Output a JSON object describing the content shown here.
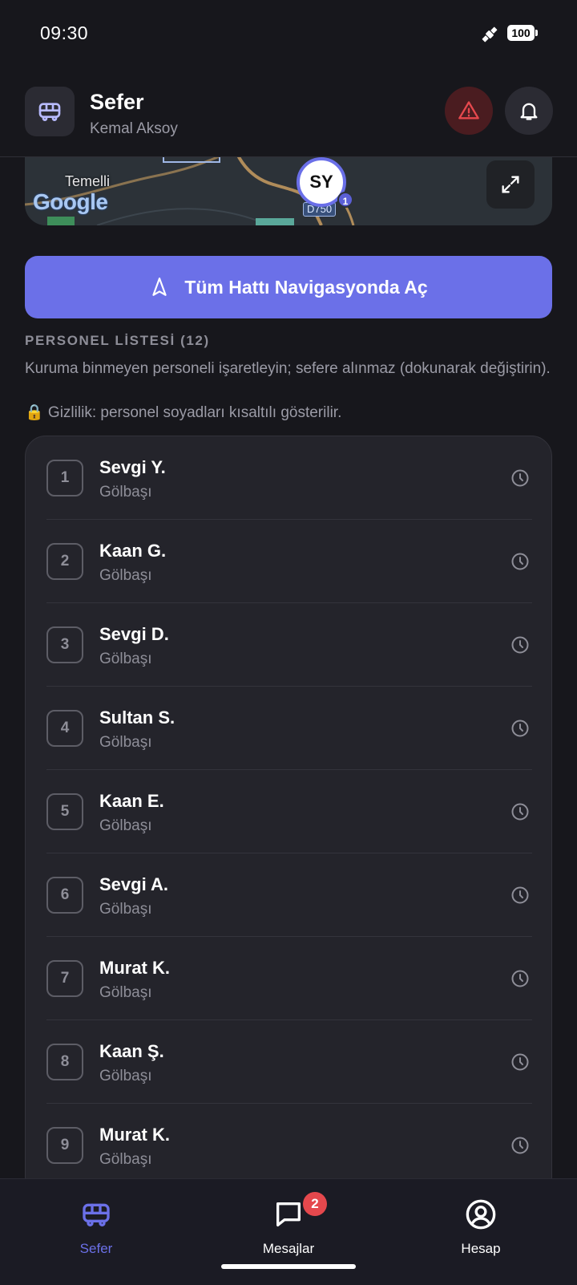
{
  "status": {
    "time": "09:30",
    "battery": "100"
  },
  "header": {
    "title": "Sefer",
    "subtitle": "Kemal Aksoy"
  },
  "map": {
    "place": "Temelli",
    "logo": "Google",
    "road_label": "D750",
    "marker_initials": "SY",
    "marker_count": "1"
  },
  "navigation_button": {
    "label": "Tüm Hattı Navigasyonda Aç"
  },
  "personnel": {
    "title": "PERSONEL LİSTESİ (12)",
    "description": "Kuruma binmeyen personeli işaretleyin; sefere alınmaz (dokunarak değiştirin).",
    "privacy": "🔒 Gizlilik: personel soyadları kısaltılı gösterilir.",
    "rows": [
      {
        "index": "1",
        "name": "Sevgi Y.",
        "location": "Gölbaşı"
      },
      {
        "index": "2",
        "name": "Kaan G.",
        "location": "Gölbaşı"
      },
      {
        "index": "3",
        "name": "Sevgi D.",
        "location": "Gölbaşı"
      },
      {
        "index": "4",
        "name": "Sultan S.",
        "location": "Gölbaşı"
      },
      {
        "index": "5",
        "name": "Kaan E.",
        "location": "Gölbaşı"
      },
      {
        "index": "6",
        "name": "Sevgi A.",
        "location": "Gölbaşı"
      },
      {
        "index": "7",
        "name": "Murat K.",
        "location": "Gölbaşı"
      },
      {
        "index": "8",
        "name": "Kaan Ş.",
        "location": "Gölbaşı"
      },
      {
        "index": "9",
        "name": "Murat K.",
        "location": "Gölbaşı"
      }
    ]
  },
  "bottom_nav": {
    "tabs": [
      {
        "label": "Sefer",
        "active": true
      },
      {
        "label": "Mesajlar",
        "badge": "2"
      },
      {
        "label": "Hesap"
      }
    ]
  },
  "colors": {
    "accent": "#6b70e8",
    "background": "#17171c",
    "card": "#24242b",
    "alert": "#e5484d"
  }
}
